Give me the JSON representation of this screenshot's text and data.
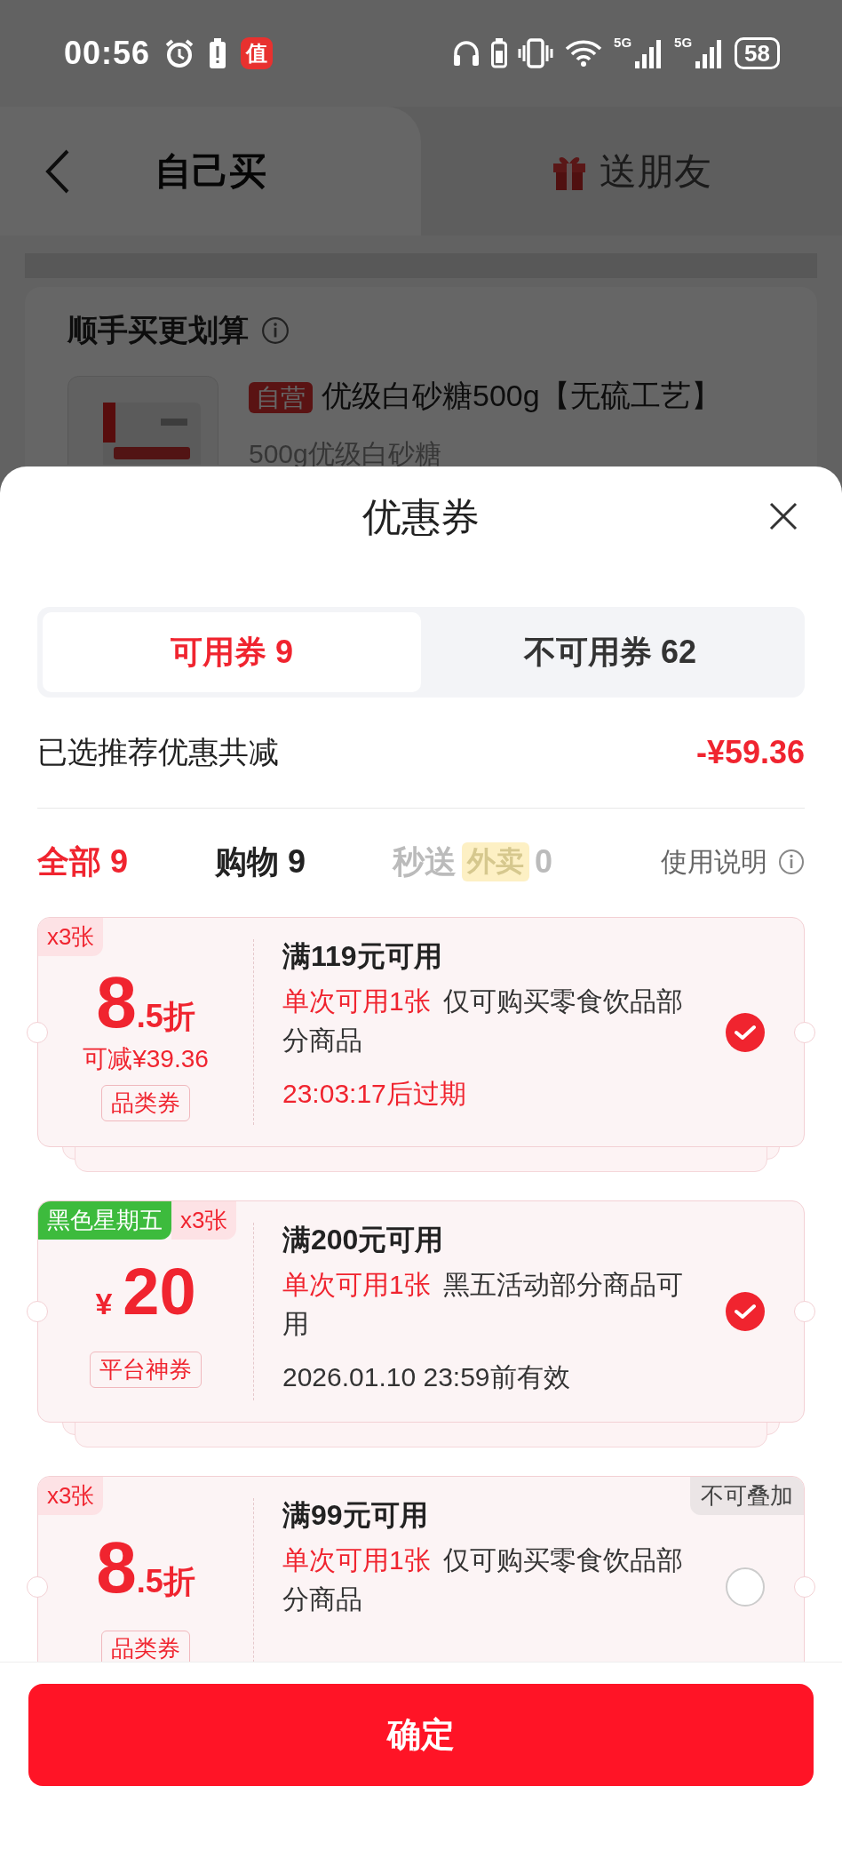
{
  "status_bar": {
    "time": "00:56",
    "app_badge": "值",
    "networks": [
      "5G",
      "5G"
    ],
    "battery": "58"
  },
  "header": {
    "tabs": [
      {
        "label": "自己买",
        "selected": true
      },
      {
        "label": "送朋友",
        "selected": false
      }
    ]
  },
  "upsell": {
    "title": "顺手买更划算",
    "product": {
      "kind": "picture",
      "badge": "自营",
      "name": "优级白砂糖500g【无硫工艺】",
      "description": "500g优级白砂糖"
    }
  },
  "sheet": {
    "title": "优惠券",
    "tabs": [
      {
        "label": "可用券 9",
        "selected": true
      },
      {
        "label": "不可用券 62",
        "selected": false
      }
    ],
    "summary": {
      "label": "已选推荐优惠共减",
      "amount": "-¥59.36"
    },
    "filters": [
      {
        "label": "全部",
        "count": "9",
        "selected": true,
        "disabled": false
      },
      {
        "label": "购物",
        "count": "9",
        "selected": false,
        "disabled": false
      },
      {
        "label": "秒送",
        "tag": "外卖",
        "count": "0",
        "selected": false,
        "disabled": true
      }
    ],
    "help": "使用说明",
    "coupons": [
      {
        "kind": "discount",
        "quantity": "x3张",
        "value_main": "8",
        "value_sub": ".5折",
        "saving": "可减¥39.36",
        "type_tag": "品类券",
        "title": "满119元可用",
        "limit": "单次可用1张",
        "scope": "仅可购买零食饮品部分商品",
        "validity": "23:03:17后过期",
        "urgent": true,
        "checked": true
      },
      {
        "kind": "cash",
        "promo": "黑色星期五",
        "quantity": "x3张",
        "currency": "¥",
        "value_main": "20",
        "type_tag": "平台神券",
        "title": "满200元可用",
        "limit": "单次可用1张",
        "scope": "黑五活动部分商品可用",
        "validity": "2026.01.10 23:59前有效",
        "urgent": false,
        "checked": true
      },
      {
        "kind": "discount",
        "quantity": "x3张",
        "value_main": "8",
        "value_sub": ".5折",
        "type_tag": "品类券",
        "note": "不可叠加",
        "title": "满99元可用",
        "limit": "单次可用1张",
        "scope": "仅可购买零食饮品部分商品",
        "checked": false
      }
    ],
    "confirm": "确定"
  }
}
